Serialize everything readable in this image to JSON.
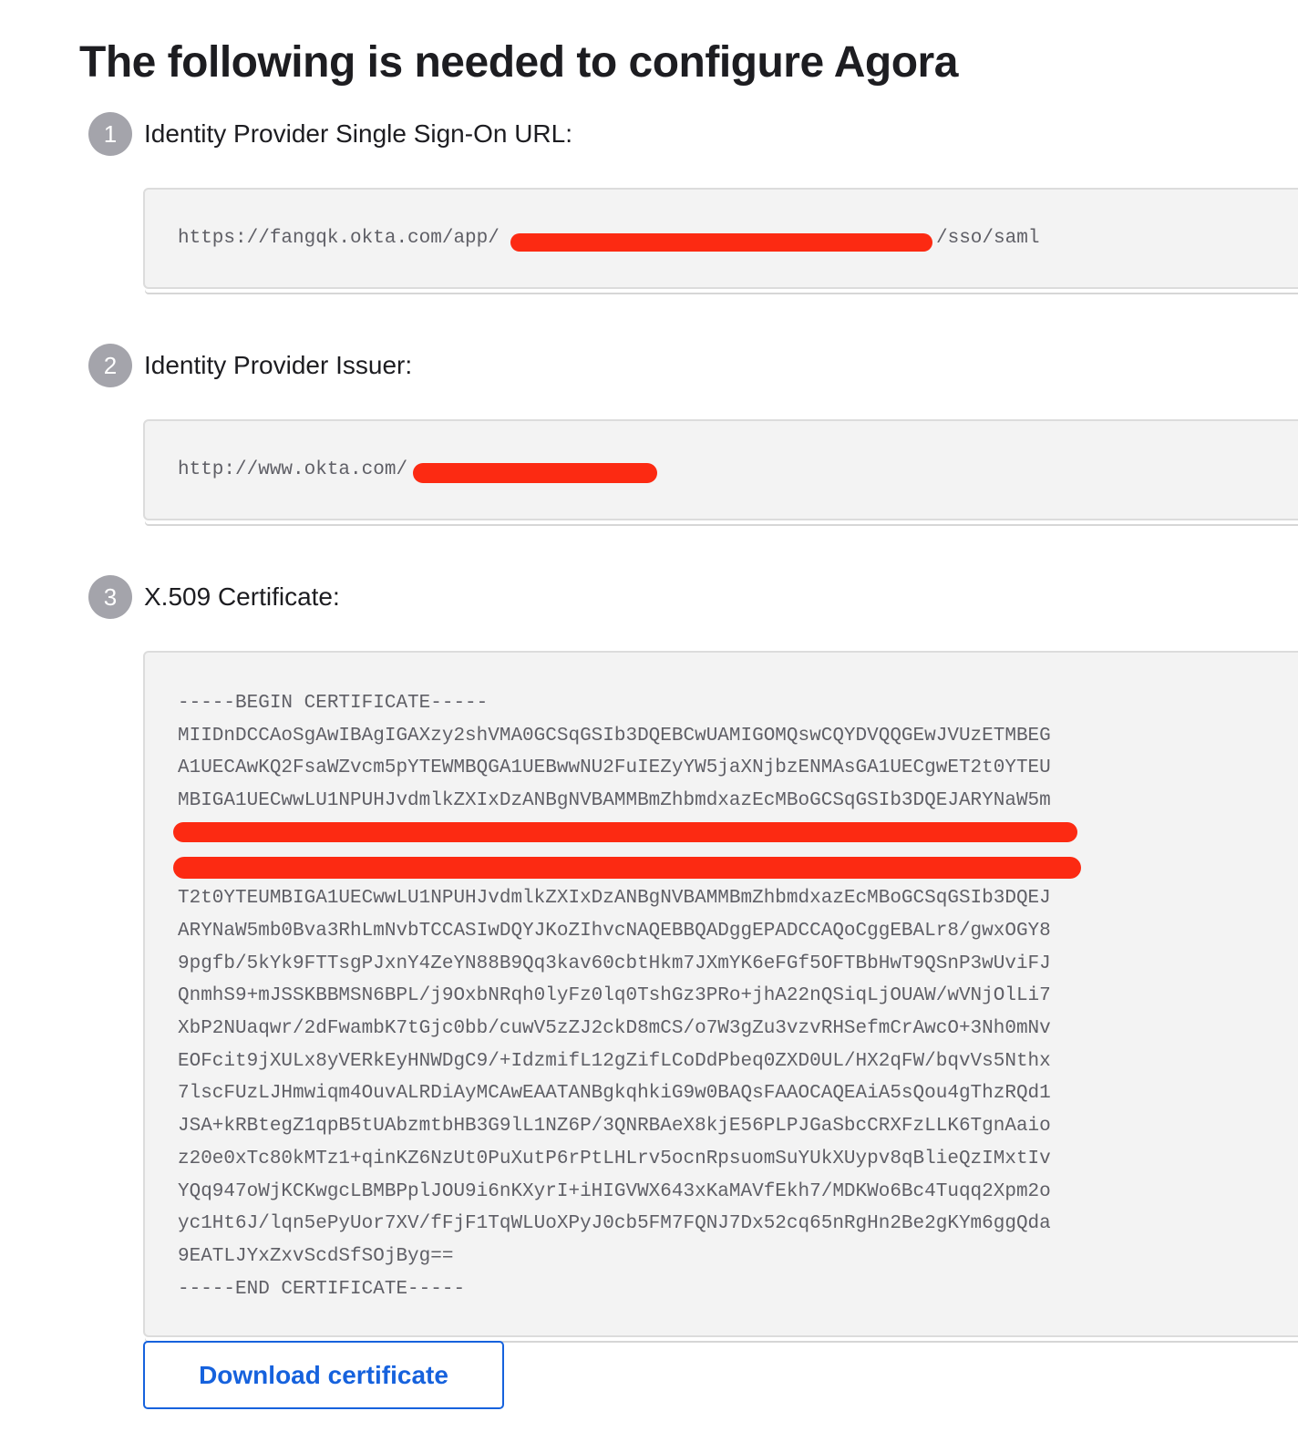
{
  "page": {
    "title": "The following is needed to configure Agora"
  },
  "steps": [
    {
      "number": "1",
      "label": "Identity Provider Single Sign-On URL:",
      "value_prefix": "https://fangqk.okta.com/app/",
      "value_suffix": "/sso/saml"
    },
    {
      "number": "2",
      "label": "Identity Provider Issuer:",
      "value_prefix": "http://www.okta.com/"
    },
    {
      "number": "3",
      "label": "X.509 Certificate:",
      "certificate_lines": [
        "-----BEGIN CERTIFICATE-----",
        "MIIDnDCCAoSgAwIBAgIGAXzy2shVMA0GCSqGSIb3DQEBCwUAMIGOMQswCQYDVQQGEwJVUzETMBEG",
        "A1UECAwKQ2FsaWZvcm5pYTEWMBQGA1UEBwwNU2FuIEZyYW5jaXNjbzENMAsGA1UECgwET2t0YTEU",
        "MBIGA1UECwwLU1NPUHJvdmlkZXIxDzANBgNVBAMMBmZhbmdxazEcMBoGCSqGSIb3DQEJARYNaW5m",
        "",
        "",
        "T2t0YTEUMBIGA1UECwwLU1NPUHJvdmlkZXIxDzANBgNVBAMMBmZhbmdxazEcMBoGCSqGSIb3DQEJ",
        "ARYNaW5mb0Bva3RhLmNvbTCCASIwDQYJKoZIhvcNAQEBBQADggEPADCCAQoCggEBALr8/gwxOGY8",
        "9pgfb/5kYk9FTTsgPJxnY4ZeYN88B9Qq3kav60cbtHkm7JXmYK6eFGf5OFTBbHwT9QSnP3wUviFJ",
        "QnmhS9+mJSSKBBMSN6BPL/j9OxbNRqh0lyFz0lq0TshGz3PRo+jhA22nQSiqLjOUAW/wVNjOlLi7",
        "XbP2NUaqwr/2dFwambK7tGjc0bb/cuwV5zZJ2ckD8mCS/o7W3gZu3vzvRHSefmCrAwcO+3Nh0mNv",
        "EOFcit9jXULx8yVERkEyHNWDgC9/+IdzmifL12gZifLCoDdPbeq0ZXD0UL/HX2qFW/bqvVs5Nthx",
        "7lscFUzLJHmwiqm4OuvALRDiAyMCAwEAATANBgkqhkiG9w0BAQsFAAOCAQEAiA5sQou4gThzRQd1",
        "JSA+kRBtegZ1qpB5tUAbzmtbHB3G9lL1NZ6P/3QNRBAeX8kjE56PLPJGaSbcCRXFzLLK6TgnAaio",
        "z20e0xTc80kMTz1+qinKZ6NzUt0PuXutP6rPtLHLrv5ocnRpsuomSuYUkXUypv8qBlieQzIMxtIv",
        "YQq947oWjKCKwgcLBMBPplJOU9i6nKXyrI+iHIGVWX643xKaMAVfEkh7/MDKWo6Bc4Tuqq2Xpm2o",
        "yc1Ht6J/lqn5ePyUor7XV/fFjF1TqWLUoXPyJ0cb5FM7FQNJ7Dx52cq65nRgHn2Be2gKYm6ggQda",
        "9EATLJYxZxvScdSfSOjByg==",
        "-----END CERTIFICATE-----"
      ]
    }
  ],
  "download_button": {
    "label": "Download certificate"
  },
  "colors": {
    "redaction": "#fc2a12",
    "link_blue": "#1662dd",
    "step_badge": "#a4a4ab",
    "box_background": "#f3f3f3"
  }
}
